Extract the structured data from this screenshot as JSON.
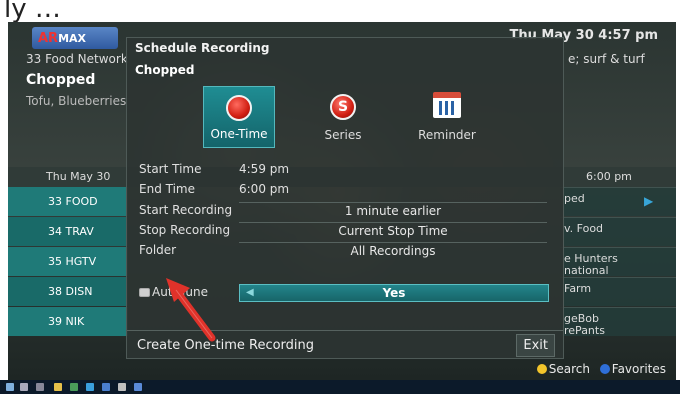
{
  "caption": "ly …",
  "header": {
    "logo_text": "MAX",
    "logo_prefix": "AR",
    "datetime": "Thu May 30 4:57 pm",
    "left_channel": "33 Food Network",
    "left_show": "Chopped",
    "left_desc": "Tofu, Blueberries",
    "right_desc": "e; surf & turf"
  },
  "guide": {
    "date": "Thu May 30",
    "time_slot": "6:00 pm",
    "channels": [
      "33 FOOD",
      "34 TRAV",
      "35 HGTV",
      "38 DISN",
      "39 NIK"
    ],
    "right_cells": [
      "ped",
      "v. Food",
      "e Hunters\nnational",
      "Farm",
      "geBob\nrePants"
    ],
    "arrow": "▶"
  },
  "dialog": {
    "title": "Schedule Recording",
    "show": "Chopped",
    "types": [
      {
        "label": "One-Time",
        "icon": "record-icon",
        "selected": true
      },
      {
        "label": "Series",
        "icon": "series-icon",
        "selected": false
      },
      {
        "label": "Reminder",
        "icon": "calendar-icon",
        "selected": false
      }
    ],
    "series_letter": "S",
    "start_time_label": "Start Time",
    "start_time": "4:59 pm",
    "end_time_label": "End Time",
    "end_time": "6:00 pm",
    "start_recording_label": "Start Recording",
    "start_recording": "1 minute earlier",
    "stop_recording_label": "Stop Recording",
    "stop_recording": "Current Stop Time",
    "folder_label": "Folder",
    "folder": "All Recordings",
    "autotune_label": "AutoTune",
    "autotune_value": "Yes",
    "create_label": "Create One-time Recording",
    "exit_label": "Exit"
  },
  "legend": {
    "search": "Search",
    "favorites": "Favorites"
  },
  "colors": {
    "accent_teal": "#1f8d93",
    "record_red": "#d11e12",
    "annotation_arrow": "#e0322a"
  }
}
